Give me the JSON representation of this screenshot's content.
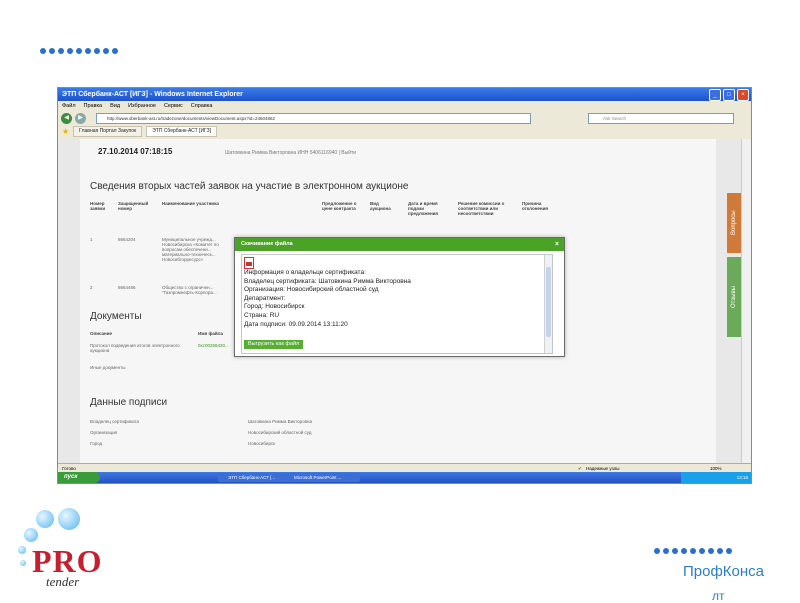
{
  "slide": {
    "brand_text": "ПрофКонса",
    "brand_text_cut": "лт",
    "logo_tender": "tender",
    "logo_pro": "PRO"
  },
  "window": {
    "title": "ЭТП Сбербанк-АСТ [ИГЗ] - Windows Internet Explorer",
    "menu": [
      "Файл",
      "Правка",
      "Вид",
      "Избранное",
      "Сервис",
      "Справка"
    ],
    "address": "http://www.sberbank-ast.ru/tradezone/documents/viewDocument.aspx?id=24604862",
    "search_placeholder": "Ask Search",
    "tabs": [
      "Главная Портал Закупок",
      "ЭТП Сбербанк-АСТ [ИГЗ]"
    ],
    "status_left": "Готово",
    "status_zone": "Надежные узлы",
    "zoom": "100%"
  },
  "taskbar": {
    "start": "пуск",
    "items": [
      "ЭТП Сбербанк-АСТ [...",
      "Microsoft PowerPoint ..."
    ],
    "clock": "13:18"
  },
  "page": {
    "datetime": "27.10.2014 07:18:15",
    "user": "Шатовкина Римма Викторовна ИНН 5406116940 | Выйти",
    "section_bids": "Сведения вторых частей заявок на участие в электронном аукционе",
    "bids_headers": [
      "Номер заявки",
      "Защищенный номер",
      "Наименование участника",
      "Предложение о цене контракта",
      "Вид аукциона",
      "Дата и время подачи предложения",
      "Решение комиссии о соответствии или несоответствии",
      "Причина отклонения"
    ],
    "bids_rows": [
      {
        "num": "1",
        "protected": "8664204",
        "name": "Муниципальное учрежд... Новосибирска «Комитет по вопросам обеспечени... материально-техническ... Новосибгорресурс»"
      },
      {
        "num": "2",
        "protected": "8664486",
        "name": "Общество с ограничен... \"Газпромнефть-Корпора..."
      }
    ],
    "section_docs": "Документы",
    "docs_headers": [
      "Описание",
      "Имя файла"
    ],
    "docs_rows": [
      {
        "desc": "Протокол подведения итогов электронного аукциона",
        "file": "0xc00259420..."
      },
      {
        "desc": "Иные документы",
        "file": ""
      }
    ],
    "section_signature": "Данные подписи",
    "sig_rows": [
      {
        "label": "Владелец сертификата",
        "value": "Шатовкина Римма Викторовна"
      },
      {
        "label": "Организация",
        "value": "Новосибирский областной суд"
      },
      {
        "label": "Город",
        "value": "Новосибирск"
      }
    ],
    "side_tabs": [
      "Вопросы",
      "Отзывы"
    ]
  },
  "dialog": {
    "title": "Скачивание файла",
    "close": "×",
    "lines": [
      "Информация о владельце сертификата:",
      "Владелец сертификата: Шатовкина Римма Викторовна",
      "Организация: Новосибирский областной суд",
      "Депаратмент:",
      "Город: Новосибирск",
      "Страна: RU",
      "Дата подписи: 09.09.2014 13:11:20"
    ],
    "button": "Выгрузить как файл"
  },
  "colors": {
    "accent_green": "#4aa324",
    "brand_blue": "#2a7fc8",
    "logo_red": "#c62030"
  }
}
